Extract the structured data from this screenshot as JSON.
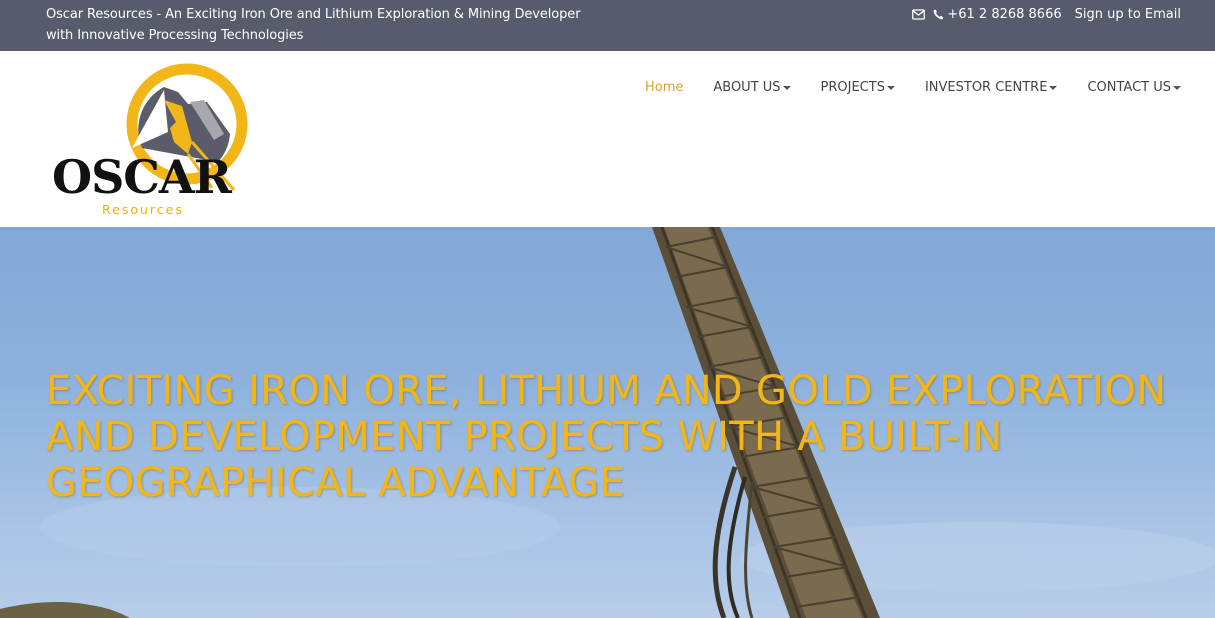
{
  "topbar": {
    "tagline": "Oscar Resources - An Exciting Iron Ore and Lithium Exploration & Mining Developer with Innovative Processing Technologies",
    "phone": "+61 2 8268 8666",
    "signup_label": "Sign up to Email",
    "icons": [
      "mail-icon",
      "phone-icon"
    ]
  },
  "logo": {
    "name": "OSCAR",
    "subname": "Resources",
    "colors": {
      "ring": "#f2b619",
      "mountain": "#5a5b69",
      "text": "#111111"
    }
  },
  "nav": {
    "items": [
      {
        "label": "Home",
        "active": true,
        "dropdown": false
      },
      {
        "label": "ABOUT US",
        "active": false,
        "dropdown": true
      },
      {
        "label": "PROJECTS",
        "active": false,
        "dropdown": true
      },
      {
        "label": "INVESTOR CENTRE",
        "active": false,
        "dropdown": true
      },
      {
        "label": "CONTACT US",
        "active": false,
        "dropdown": true
      }
    ],
    "active_color": "#d9a520"
  },
  "hero": {
    "headline": "EXCITING IRON ORE, LITHIUM AND GOLD EXPLORATION AND DEVELOPMENT PROJECTS WITH A BUILT-IN GEOGRAPHICAL ADVANTAGE",
    "headline_color": "#f2b619"
  },
  "colors": {
    "topbar_bg": "#585b6b",
    "sky": "#8eb2dd"
  }
}
